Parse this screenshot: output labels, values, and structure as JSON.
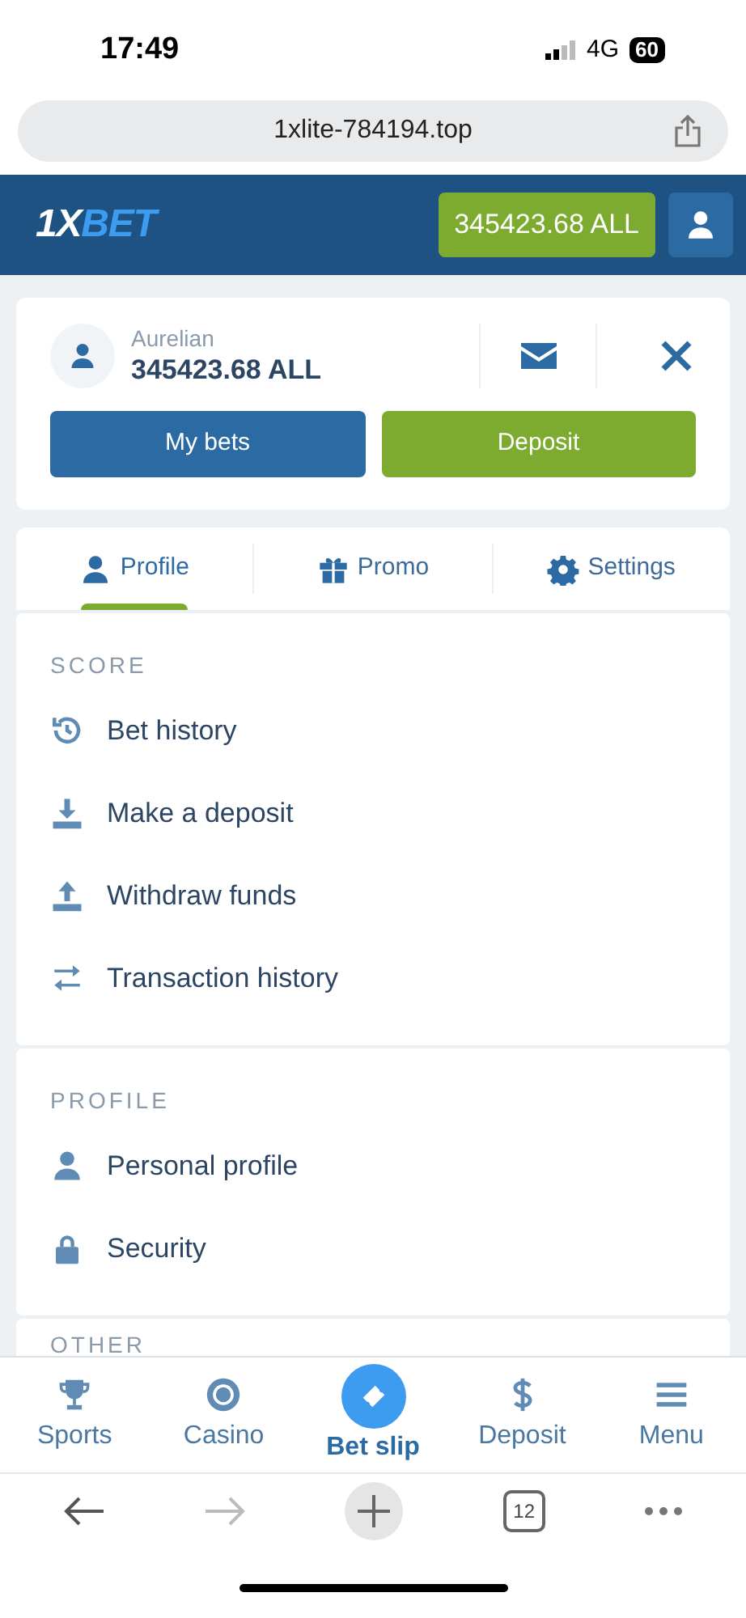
{
  "status_bar": {
    "time": "17:49",
    "network": "4G",
    "battery": "60"
  },
  "browser": {
    "url": "1xlite-784194.top"
  },
  "header": {
    "logo_prefix": "1X",
    "logo_suffix": "BET",
    "balance": "345423.68 ALL"
  },
  "account": {
    "name": "Aurelian",
    "balance": "345423.68 ALL",
    "buttons": [
      {
        "label": "My bets",
        "kind": "primary"
      },
      {
        "label": "Deposit",
        "kind": "accent"
      }
    ]
  },
  "tabs": [
    {
      "label": "Profile",
      "selected": true
    },
    {
      "label": "Promo",
      "selected": false
    },
    {
      "label": "Settings",
      "selected": false
    }
  ],
  "sections": [
    {
      "title": "SCORE",
      "items": [
        {
          "label": "Bet history"
        },
        {
          "label": "Make a deposit"
        },
        {
          "label": "Withdraw funds"
        },
        {
          "label": "Transaction history"
        }
      ]
    },
    {
      "title": "PROFILE",
      "items": [
        {
          "label": "Personal profile"
        },
        {
          "label": "Security"
        }
      ]
    },
    {
      "title": "OTHER"
    }
  ],
  "bottom_nav": [
    {
      "label": "Sports",
      "selected": false
    },
    {
      "label": "Casino",
      "selected": false
    },
    {
      "label": "Bet slip",
      "selected": true
    },
    {
      "label": "Deposit",
      "selected": false
    },
    {
      "label": "Menu",
      "selected": false
    }
  ],
  "browser_toolbar": {
    "back_disabled": false,
    "forward_disabled": true,
    "tab_count": "12"
  }
}
